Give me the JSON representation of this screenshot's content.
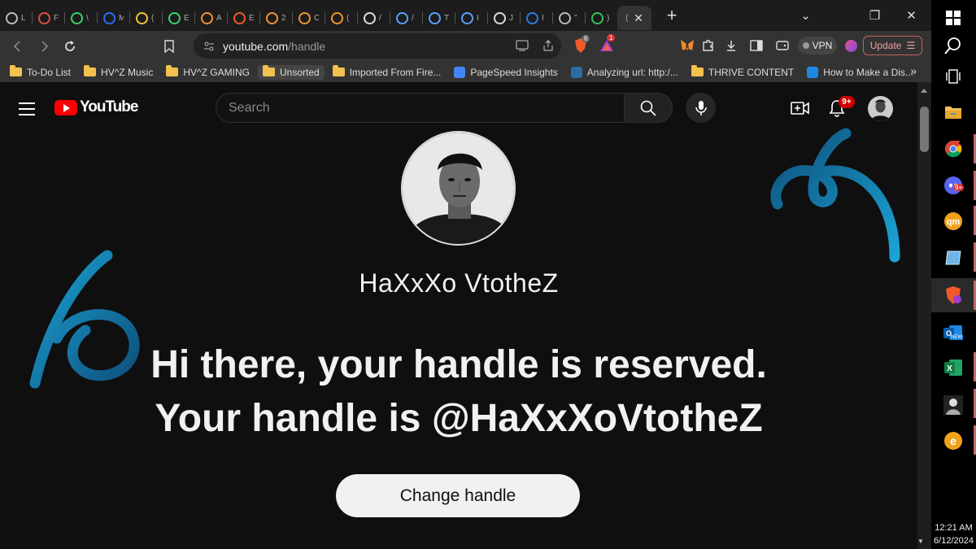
{
  "browser": {
    "tabs": [
      {
        "icon": "globe-icon",
        "title": "L",
        "color": "#bbbbbb"
      },
      {
        "icon": "triangle-icon",
        "title": "F",
        "color": "#e04f3f"
      },
      {
        "icon": "leaf-icon",
        "title": "\\",
        "color": "#3bd36b"
      },
      {
        "icon": "circle-c-icon",
        "title": "M",
        "color": "#2b6cff"
      },
      {
        "icon": "smiley-icon",
        "title": "(",
        "color": "#f3c531"
      },
      {
        "icon": "swirl-icon",
        "title": "E",
        "color": "#3bd36b"
      },
      {
        "icon": "bitcoin-icon",
        "title": "A",
        "color": "#f29431"
      },
      {
        "icon": "brave-icon",
        "title": "E",
        "color": "#f05a28"
      },
      {
        "icon": "bitcoin-icon",
        "title": "2",
        "color": "#f29431"
      },
      {
        "icon": "bitcoin-icon",
        "title": "C",
        "color": "#f29431"
      },
      {
        "icon": "bitcoin-icon",
        "title": "(",
        "color": "#f29431"
      },
      {
        "icon": "ring-icon",
        "title": "/",
        "color": "#dddddd"
      },
      {
        "icon": "circle-icon",
        "title": "/",
        "color": "#5aa0ff"
      },
      {
        "icon": "circle-icon",
        "title": "T",
        "color": "#5aa0ff"
      },
      {
        "icon": "circle-icon",
        "title": "I",
        "color": "#5aa0ff"
      },
      {
        "icon": "circle-c-icon",
        "title": "J",
        "color": "#dddddd"
      },
      {
        "icon": "ship-icon",
        "title": "I",
        "color": "#2c7be5"
      },
      {
        "icon": "f-circle-icon",
        "title": "\"",
        "color": "#bbbbbb"
      },
      {
        "icon": "feather-icon",
        "title": ")",
        "color": "#35c35a"
      }
    ],
    "active_tab": {
      "title": "(",
      "close": "✕"
    },
    "new_tab": "+",
    "window_controls": {
      "dropdown": "⌄",
      "restore": "❐",
      "close": "✕"
    },
    "url_host": "youtube.com",
    "url_path": "/handle",
    "brave_badge": "6",
    "rewards_badge": "1",
    "vpn_label": "VPN",
    "update_label": "Update",
    "bookmarks": [
      {
        "type": "folder",
        "label": "To-Do List"
      },
      {
        "type": "folder",
        "label": "HV^Z Music"
      },
      {
        "type": "folder",
        "label": "HV^Z GAMING"
      },
      {
        "type": "folder",
        "label": "Unsorted",
        "selected": true
      },
      {
        "type": "folder",
        "label": "Imported From Fire..."
      },
      {
        "type": "site",
        "label": "PageSpeed Insights",
        "color": "#4285f4"
      },
      {
        "type": "site",
        "label": "Analyzing url: http:/...",
        "color": "#2d6ca2"
      },
      {
        "type": "folder",
        "label": "THRIVE CONTENT"
      },
      {
        "type": "site",
        "label": "How to Make a Dis...",
        "color": "#1e88e5"
      }
    ],
    "bookmarks_more": "»"
  },
  "youtube": {
    "logo_text": "YouTube",
    "search_placeholder": "Search",
    "notification_count": "9+",
    "channel_name": "HaXxXo VtotheZ",
    "headline_line1": "Hi there, your handle is reserved.",
    "headline_line2": "Your handle is @HaXxXoVtotheZ",
    "change_handle_label": "Change handle",
    "accent_color": "#1ba3d6"
  },
  "taskbar": {
    "apps": [
      "windows-start-icon",
      "search-icon",
      "task-view-icon",
      "file-explorer-icon",
      "chrome-icon",
      "discord-icon",
      "qm-icon",
      "notes-icon",
      "brave-icon",
      "outlook-icon",
      "excel-icon",
      "gamer-icon",
      "e-app-icon"
    ],
    "outlook_badge": "NEW",
    "discord_badge": "9+",
    "time": "12:21 AM",
    "date": "6/12/2024"
  }
}
